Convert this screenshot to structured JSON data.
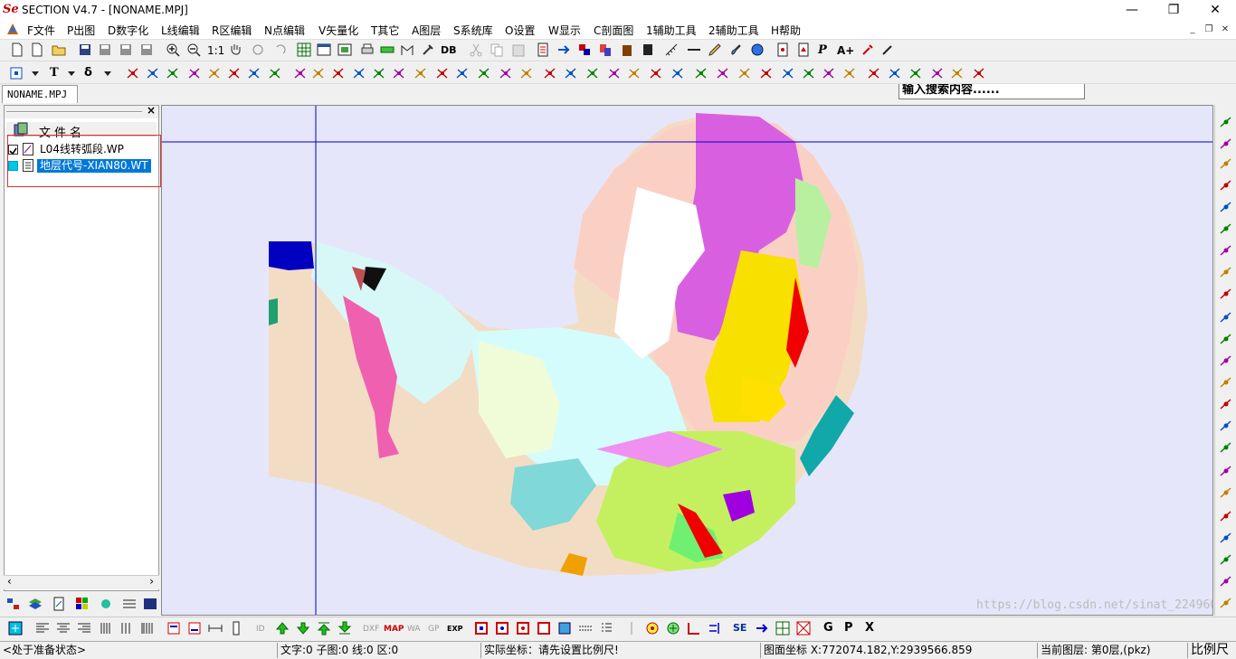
{
  "title": {
    "logo": "Se",
    "text": "SECTION V4.7 - [NONAME.MPJ]"
  },
  "window_buttons": {
    "minimize": "—",
    "restore": "❐",
    "close": "✕"
  },
  "menu": [
    "F文件",
    "P出图",
    "D数字化",
    "L线编辑",
    "R区编辑",
    "N点编辑",
    "V矢量化",
    "T其它",
    "A图层",
    "S系统库",
    "O设置",
    "W显示",
    "C剖面图",
    "1辅助工具",
    "2辅助工具",
    "H帮助"
  ],
  "mdi": {
    "min": "_",
    "restore": "❐",
    "close": "✕"
  },
  "toolbar1": {
    "zoom11": "1:1",
    "db": "DB",
    "p": "P",
    "aplus": "A+",
    "search_value": "输入搜索内容......"
  },
  "toolbar2": {
    "t": "T",
    "delta": "δ"
  },
  "doc_tab": "NONAME.MPJ",
  "panel": {
    "close": "×",
    "column": "文件名",
    "layers": [
      {
        "name": "L04线转弧段.WP",
        "checked": true,
        "selected": false
      },
      {
        "name": "地层代号-XIAN80.WT",
        "checked": false,
        "selected": true
      }
    ]
  },
  "bottom_toolbar": {
    "id": "ID",
    "dxf": "DXF",
    "map": "MAP",
    "wa": "WA",
    "gp": "GP",
    "exp": "EXP",
    "g": "G",
    "p": "P",
    "x": "X"
  },
  "status": {
    "state": "<处于准备状态>",
    "counts": "文字:0 子图:0 线:0 区:0",
    "actual": "实际坐标：请先设置比例尺!",
    "map": "图面坐标 X:772074.182,Y:2939566.859",
    "layer": "当前图层: 第0层,(pkz)",
    "scale": "比例尺"
  },
  "watermark": "https://blog.csdn.net/sinat_22496067",
  "colors": {
    "map_bg": "#e6e6fa",
    "selection": "#0078d7",
    "cursor_line": "#0000cc"
  }
}
